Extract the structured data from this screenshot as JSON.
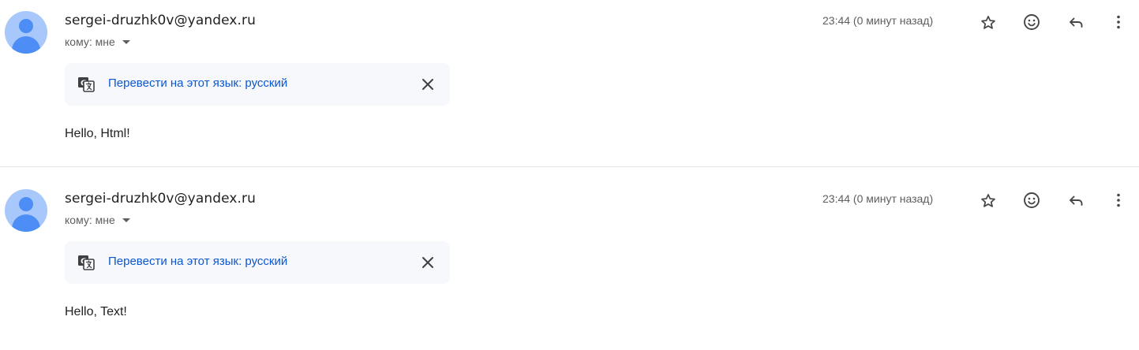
{
  "messages": [
    {
      "sender": "sergei-druzhk0v@yandex.ru",
      "recipient": "кому: мне",
      "timestamp": "23:44 (0 минут назад)",
      "translate_link": "Перевести на этот язык: русский",
      "body": "Hello, Html!"
    },
    {
      "sender": "sergei-druzhk0v@yandex.ru",
      "recipient": "кому: мне",
      "timestamp": "23:44 (0 минут назад)",
      "translate_link": "Перевести на этот язык: русский",
      "body": "Hello, Text!"
    }
  ],
  "icons": {
    "avatar": "avatar-icon",
    "star": "star-icon",
    "emoji": "emoji-reaction-icon",
    "reply": "reply-icon",
    "more": "more-vert-icon",
    "translate": "translate-icon",
    "close": "close-icon",
    "caret": "caret-down-icon"
  },
  "colors": {
    "avatar_background": "#a8c7fa",
    "avatar_figure": "#4c8df6",
    "link": "#0b57d0",
    "translate_bar_background": "#f6f8fc",
    "secondary_text": "#5e5e5e"
  }
}
